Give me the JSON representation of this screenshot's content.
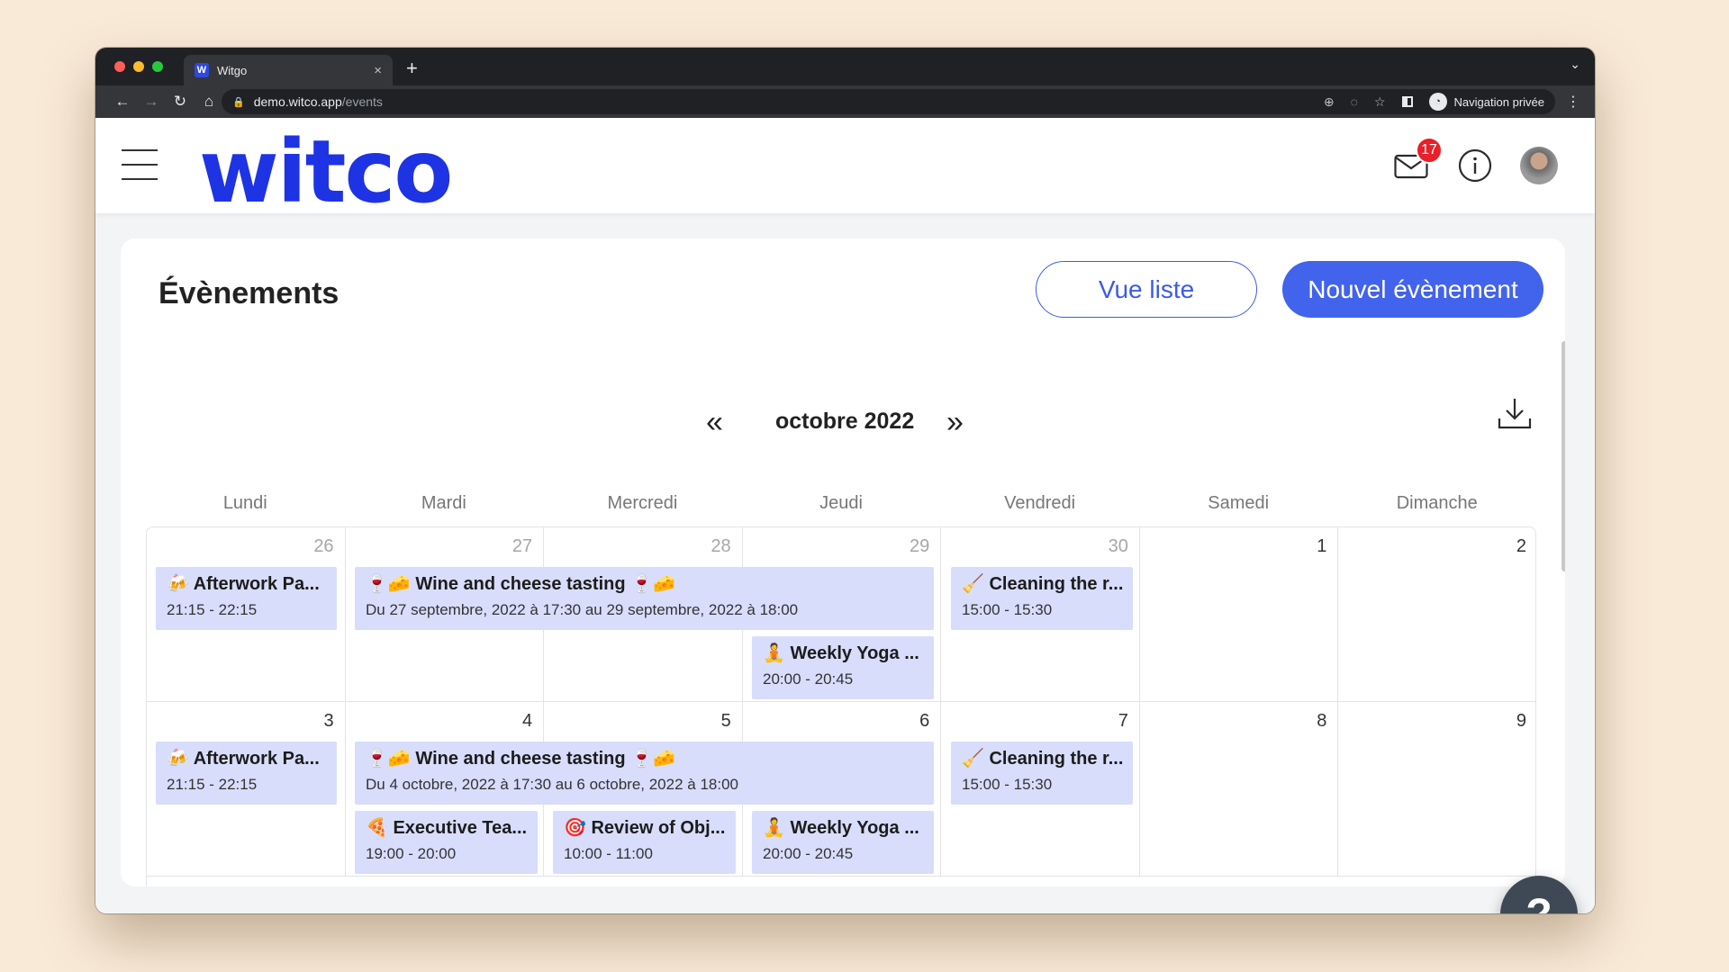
{
  "browser": {
    "tab_title": "Witgo",
    "favicon_letter": "W",
    "tab_close": "×",
    "new_tab": "+",
    "url_host": "demo.witco.app",
    "url_path": "/events",
    "private_label": "Navigation privée"
  },
  "app": {
    "logo": "witco",
    "mail_badge": "17"
  },
  "page": {
    "title": "Évènements",
    "list_view_button": "Vue liste",
    "new_event_button": "Nouvel évènement",
    "month": "octobre 2022",
    "prev_symbol": "«",
    "next_symbol": "»",
    "help_symbol": "?"
  },
  "weekdays": [
    "Lundi",
    "Mardi",
    "Mercredi",
    "Jeudi",
    "Vendredi",
    "Samedi",
    "Dimanche"
  ],
  "weeks": [
    {
      "days": [
        "26",
        "27",
        "28",
        "29",
        "30",
        "1",
        "2"
      ],
      "events": [
        {
          "title": "🍻 Afterwork Pa...",
          "time": "21:15 - 22:15"
        },
        {
          "title": "🍷🧀 Wine and cheese tasting 🍷🧀",
          "time": "Du 27 septembre, 2022 à 17:30 au 29 septembre, 2022 à 18:00"
        },
        {
          "title": "🧹 Cleaning the r...",
          "time": "15:00 - 15:30"
        },
        {
          "title": "🧘 Weekly Yoga ...",
          "time": "20:00 - 20:45"
        }
      ]
    },
    {
      "days": [
        "3",
        "4",
        "5",
        "6",
        "7",
        "8",
        "9"
      ],
      "events": [
        {
          "title": "🍻 Afterwork Pa...",
          "time": "21:15 - 22:15"
        },
        {
          "title": "🍷🧀 Wine and cheese tasting 🍷🧀",
          "time": "Du 4 octobre, 2022 à 17:30 au 6 octobre, 2022 à 18:00"
        },
        {
          "title": "🧹 Cleaning the r...",
          "time": "15:00 - 15:30"
        },
        {
          "title": "🍕 Executive Tea...",
          "time": "19:00 - 20:00"
        },
        {
          "title": "🎯 Review of Obj...",
          "time": "10:00 - 11:00"
        },
        {
          "title": "🧘 Weekly Yoga ...",
          "time": "20:00 - 20:45"
        }
      ]
    }
  ],
  "colors": {
    "brand": "#1e33e3",
    "primary_button": "#4263eb",
    "event_bg": "#d8ddfc",
    "badge": "#e8202a",
    "background": "#f9ead8"
  }
}
